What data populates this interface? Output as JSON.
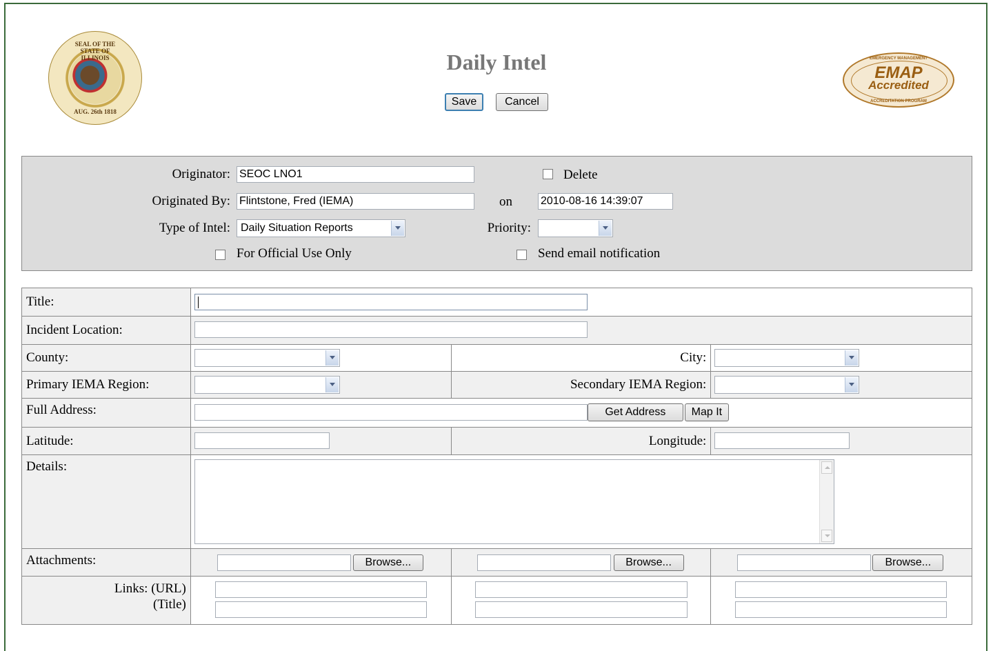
{
  "header": {
    "title": "Daily Intel",
    "save_label": "Save",
    "cancel_label": "Cancel",
    "seal_top_text": "SEAL OF THE STATE OF ILLINOIS",
    "seal_bottom_text": "AUG. 26th 1818",
    "emap_line1": "EMAP",
    "emap_line2": "Accredited",
    "emap_ring_top": "EMERGENCY MANAGEMENT",
    "emap_ring_bottom": "ACCREDITATION PROGRAM"
  },
  "panel": {
    "originator_label": "Originator:",
    "originator_value": "SEOC LNO1",
    "delete_label": "Delete",
    "originated_by_label": "Originated By:",
    "originated_by_value": "Flintstone, Fred (IEMA)",
    "on_label": "on",
    "date_value": "2010-08-16 14:39:07",
    "type_label": "Type of Intel:",
    "type_value": "Daily Situation Reports",
    "priority_label": "Priority:",
    "priority_value": "",
    "fouo_label": "For Official Use Only",
    "email_label": "Send email notification"
  },
  "form": {
    "title_label": "Title:",
    "title_value": "",
    "incident_label": "Incident Location:",
    "county_label": "County:",
    "city_label": "City:",
    "primary_region_label": "Primary IEMA Region:",
    "secondary_region_label": "Secondary IEMA Region:",
    "full_address_label": "Full Address:",
    "get_address_label": "Get Address",
    "map_it_label": "Map It",
    "latitude_label": "Latitude:",
    "longitude_label": "Longitude:",
    "details_label": "Details:",
    "attachments_label": "Attachments:",
    "browse_label": "Browse...",
    "links_url_label": "Links: (URL)",
    "links_title_label": "(Title)"
  },
  "colors": {
    "frame": "#3a6a3a",
    "panel_bg": "#dcdcdc",
    "title_text": "#777777",
    "primary_button_border": "#3c7fb1"
  }
}
